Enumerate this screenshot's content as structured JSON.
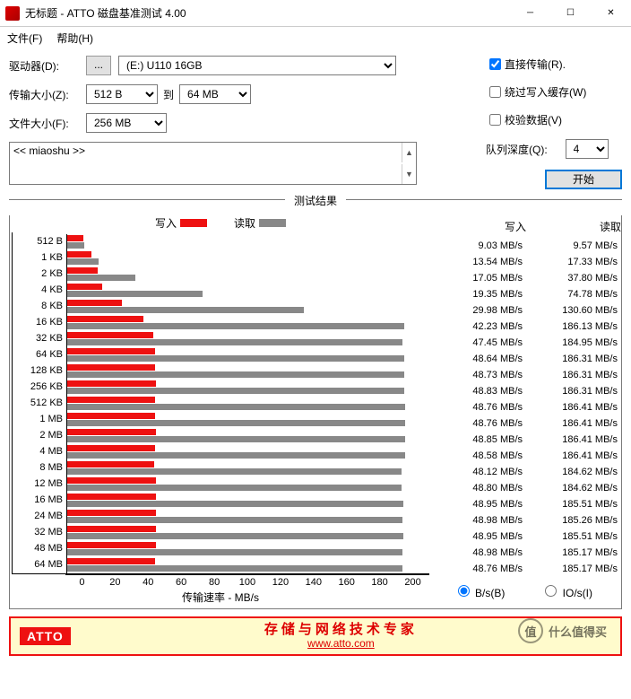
{
  "window": {
    "title": "无标题 - ATTO 磁盘基准测试 4.00"
  },
  "menu": {
    "file": "文件(F)",
    "help": "帮助(H)"
  },
  "labels": {
    "drive": "驱动器(D):",
    "drive_value": "(E:) U110 16GB",
    "transfer_size": "传输大小(Z):",
    "transfer_from": "512 B",
    "to": "到",
    "transfer_to": "64 MB",
    "file_size": "文件大小(F):",
    "file_size_value": "256 MB",
    "direct_io": "直接传输(R).",
    "bypass_cache": "绕过写入缓存(W)",
    "verify": "校验数据(V)",
    "queue_depth": "队列深度(Q):",
    "queue_value": "4",
    "start": "开始",
    "textbox": "<< miaoshu >>",
    "results_title": "测试结果",
    "legend_write": "写入",
    "legend_read": "读取",
    "xaxis": "传输速率 - MB/s",
    "col_write": "写入",
    "col_read": "读取",
    "unit_bs": "B/s(B)",
    "unit_ios": "IO/s(I)"
  },
  "footer": {
    "logo": "ATTO",
    "text": "存储与网络技术专家",
    "url": "www.atto.com"
  },
  "watermark": "什么值得买",
  "chart_data": {
    "type": "bar",
    "title": "测试结果",
    "xlabel": "传输速率 - MB/s",
    "ylabel": "",
    "xlim": [
      0,
      200
    ],
    "xticks": [
      0,
      20,
      40,
      60,
      80,
      100,
      120,
      140,
      160,
      180,
      200
    ],
    "categories": [
      "512 B",
      "1 KB",
      "2 KB",
      "4 KB",
      "8 KB",
      "16 KB",
      "32 KB",
      "64 KB",
      "128 KB",
      "256 KB",
      "512 KB",
      "1 MB",
      "2 MB",
      "4 MB",
      "8 MB",
      "12 MB",
      "16 MB",
      "24 MB",
      "32 MB",
      "48 MB",
      "64 MB"
    ],
    "series": [
      {
        "name": "写入",
        "unit": "MB/s",
        "values": [
          9.03,
          13.54,
          17.05,
          19.35,
          29.98,
          42.23,
          47.45,
          48.64,
          48.73,
          48.83,
          48.76,
          48.76,
          48.85,
          48.58,
          48.12,
          48.8,
          48.95,
          48.98,
          48.95,
          48.98,
          48.76
        ]
      },
      {
        "name": "读取",
        "unit": "MB/s",
        "values": [
          9.57,
          17.33,
          37.8,
          74.78,
          130.6,
          186.13,
          184.95,
          186.31,
          186.31,
          186.31,
          186.41,
          186.41,
          186.41,
          186.41,
          184.62,
          184.62,
          185.51,
          185.26,
          185.51,
          185.17,
          185.17
        ]
      }
    ]
  }
}
